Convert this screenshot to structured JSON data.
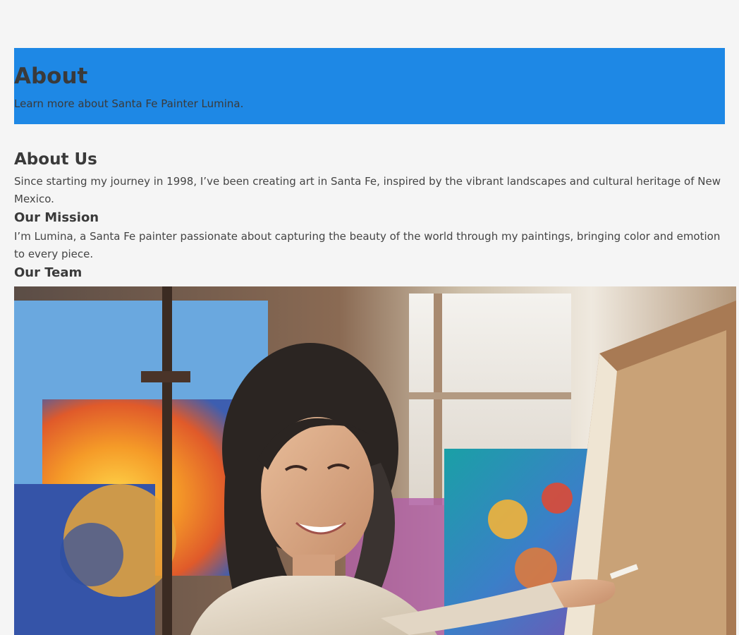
{
  "hero": {
    "title": "About",
    "subtitle": "Learn more about Santa Fe Painter Lumina."
  },
  "about": {
    "heading": "About Us",
    "text": "Since starting my journey in 1998, I’ve been creating art in Santa Fe, inspired by the vibrant landscapes and cultural heritage of New Mexico."
  },
  "mission": {
    "heading": "Our Mission",
    "text": "I’m Lumina, a Santa Fe painter passionate about capturing the beauty of the world through my paintings, bringing color and emotion to every piece."
  },
  "team": {
    "heading": "Our Team"
  },
  "colors": {
    "hero_background": "#1e88e5",
    "page_background": "#f5f5f5",
    "text": "#3a3a3a"
  }
}
